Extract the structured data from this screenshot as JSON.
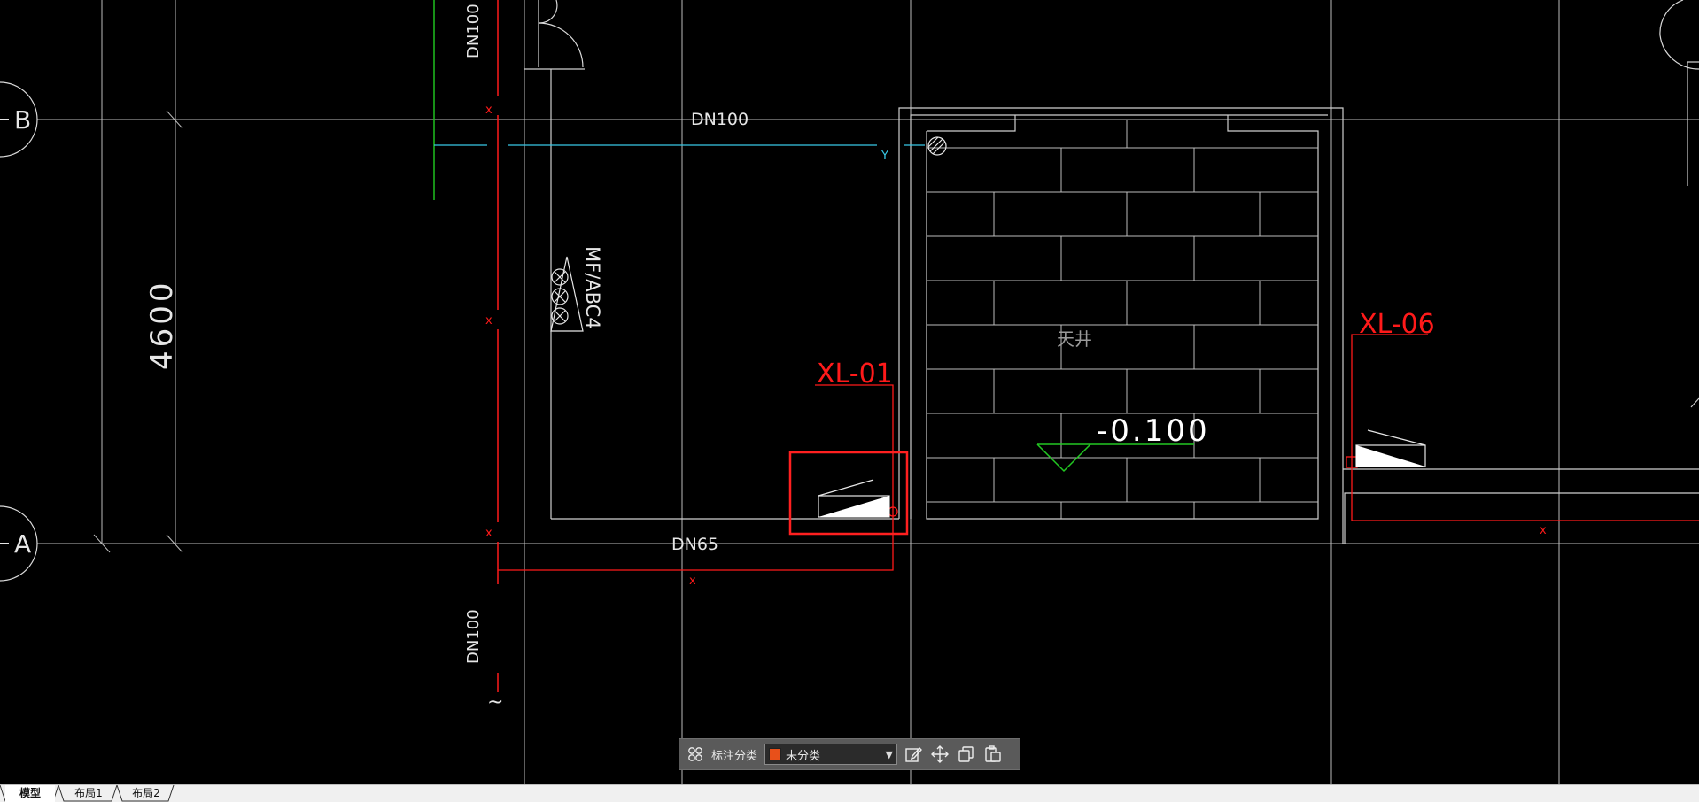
{
  "drawing": {
    "grid_bubbles": [
      "B",
      "A"
    ],
    "dimension_label": "4600",
    "pipe_labels": {
      "dn100_top": "DN100",
      "dn100_horizontal": "DN100",
      "dn65": "DN65",
      "dn100_bottom": "DN100"
    },
    "extinguisher_label": "MF/ABC4",
    "riser_tags": [
      "XL-01",
      "XL-06"
    ],
    "shaft_label": "天井",
    "elevation_label": "-0.100",
    "pipe_marks": {
      "x": "x",
      "y": "Y",
      "break": "~"
    }
  },
  "colors": {
    "background": "#000000",
    "line_white": "#d9d9d9",
    "fire_pipe_red": "#ff1a1a",
    "water_pipe_cyan": "#38c8e6",
    "green": "#1fc01f",
    "highlight_box": "#ff2020"
  },
  "toolbar": {
    "grid_icon": "grid-icon",
    "category_label": "标注分类",
    "category_value": "未分类",
    "category_color": "#e8501a",
    "edit_icon": "edit-icon",
    "move_icon": "move-icon",
    "copy_icon": "copy-icon",
    "paste_icon": "paste-icon"
  },
  "tabs": [
    "模型",
    "布局1",
    "布局2"
  ],
  "active_tab": "模型"
}
